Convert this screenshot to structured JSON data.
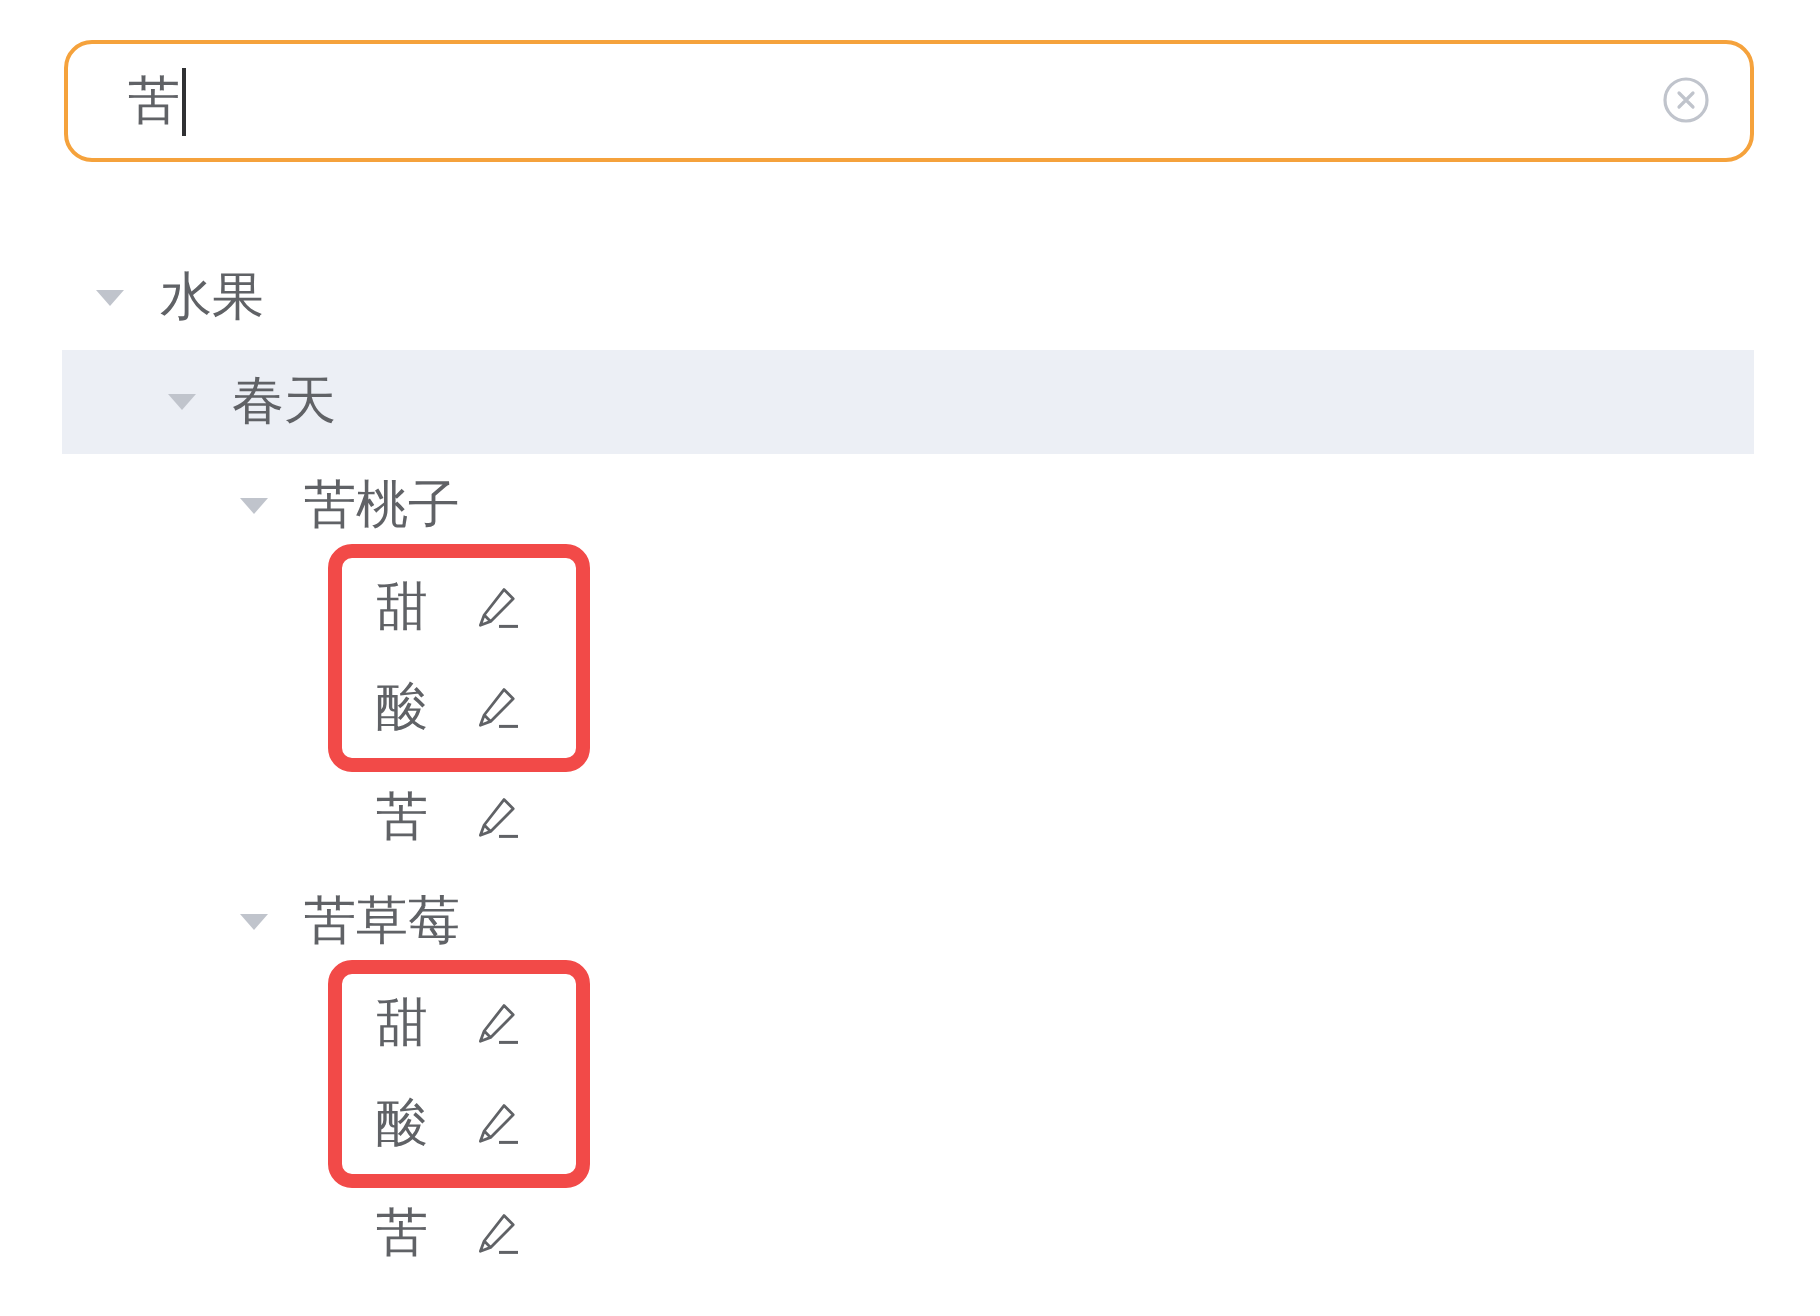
{
  "search": {
    "value": "苦",
    "focused": true
  },
  "tree": [
    {
      "label": "水果",
      "expanded": true,
      "selected": false,
      "children": [
        {
          "label": "春天",
          "expanded": true,
          "selected": true,
          "children": [
            {
              "label": "苦桃子",
              "expanded": true,
              "selected": false,
              "children": [
                {
                  "label": "甜",
                  "selected": false,
                  "outlined": true
                },
                {
                  "label": "酸",
                  "selected": false,
                  "outlined": true
                },
                {
                  "label": "苦",
                  "selected": false,
                  "outlined": false
                }
              ]
            },
            {
              "label": "苦草莓",
              "expanded": true,
              "selected": false,
              "children": [
                {
                  "label": "甜",
                  "selected": false,
                  "outlined": true
                },
                {
                  "label": "酸",
                  "selected": false,
                  "outlined": true
                },
                {
                  "label": "苦",
                  "selected": false,
                  "outlined": false
                }
              ]
            }
          ]
        }
      ]
    }
  ]
}
